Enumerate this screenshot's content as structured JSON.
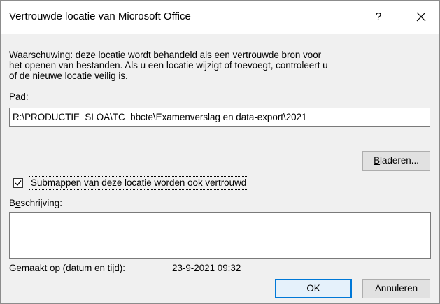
{
  "dialog": {
    "title": "Vertrouwde locatie van Microsoft Office",
    "help_label": "?",
    "warning_lines": [
      "Waarschuwing: deze locatie wordt behandeld als een vertrouwde bron voor",
      "het openen van bestanden. Als u een locatie wijzigt of toevoegt, controleert u",
      "of de nieuwe locatie veilig is."
    ],
    "path": {
      "label_hotkey": "P",
      "label_rest": "ad:",
      "value": "R:\\PRODUCTIE_SLOA\\TC_bbcte\\Examenverslag en data-export\\2021"
    },
    "browse_button": {
      "hotkey": "B",
      "rest": "laderen..."
    },
    "subfolders": {
      "checked": true,
      "label_hotkey": "S",
      "label_rest": "ubmappen van deze locatie worden ook vertrouwd"
    },
    "description": {
      "label_first": "B",
      "label_hotkey": "e",
      "label_rest": "schrijving:",
      "value": ""
    },
    "created": {
      "label": "Gemaakt op (datum en tijd):",
      "value": "23-9-2021 09:32"
    },
    "ok_label": "OK",
    "cancel_label": "Annuleren"
  },
  "icons": {
    "close": "close-icon",
    "checkmark": "checkmark-icon"
  },
  "colors": {
    "dialog_bg": "#f0f0f0",
    "titlebar_bg": "#ffffff",
    "default_button_border": "#0078d7",
    "default_button_bg": "#e5f1fb",
    "button_bg": "#e1e1e1"
  }
}
